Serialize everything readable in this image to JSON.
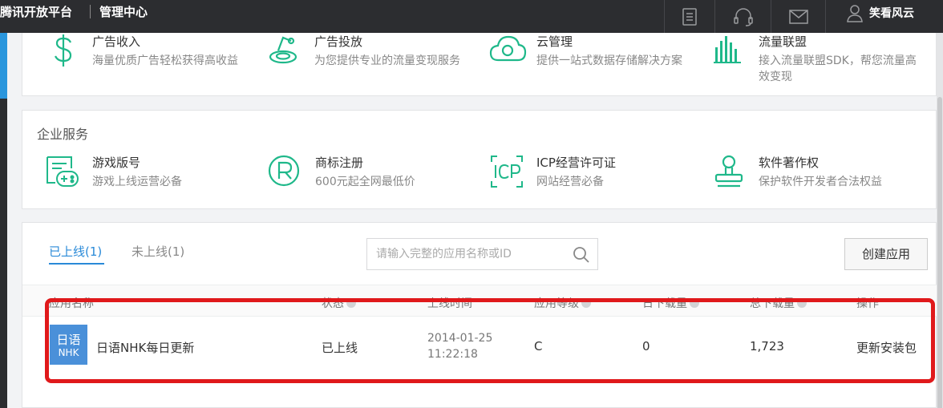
{
  "header": {
    "brand": "腾讯开放平台",
    "section": "管理中心",
    "user_name": "笑看风云",
    "nav_icons": [
      "document-icon",
      "headset-icon",
      "mail-icon",
      "user-icon"
    ]
  },
  "services_top": [
    {
      "icon": "dollar-icon",
      "title": "广告收入",
      "desc": "海量优质广告轻松获得高收益"
    },
    {
      "icon": "ad-placement-icon",
      "title": "广告投放",
      "desc": "为您提供专业的流量变现服务"
    },
    {
      "icon": "cloud-icon",
      "title": "云管理",
      "desc": "提供一站式数据存储解决方案"
    },
    {
      "icon": "bar-chart-icon",
      "title": "流量联盟",
      "desc": "接入流量联盟SDK，帮您流量高效变现"
    }
  ],
  "enterprise": {
    "title": "企业服务",
    "items": [
      {
        "icon": "game-license-icon",
        "title": "游戏版号",
        "desc": "游戏上线运营必备"
      },
      {
        "icon": "trademark-icon",
        "title": "商标注册",
        "desc": "600元起全网最低价"
      },
      {
        "icon": "icp-icon",
        "title": "ICP经营许可证",
        "desc": "网站经营必备"
      },
      {
        "icon": "stamp-icon",
        "title": "软件著作权",
        "desc": "保护软件开发者合法权益"
      }
    ]
  },
  "apps": {
    "tabs": [
      {
        "label": "已上线(1)",
        "active": true
      },
      {
        "label": "未上线(1)",
        "active": false
      }
    ],
    "search_placeholder": "请输入完整的应用名称或ID",
    "create_label": "创建应用",
    "columns": [
      "应用名称",
      "状态",
      "上线时间",
      "应用等级",
      "日下载量",
      "总下载量",
      "操作"
    ],
    "rows": [
      {
        "icon_line1": "日语",
        "icon_line2": "NHK",
        "name": "日语NHK每日更新",
        "status": "已上线",
        "online_date": "2014-01-25",
        "online_time": "11:22:18",
        "level": "C",
        "daily_downloads": "0",
        "total_downloads": "1,723",
        "action": "更新安装包"
      }
    ]
  },
  "colors": {
    "accent": "#2a8ad8",
    "service_icon": "#1fb88a",
    "highlight_border": "#e0191b",
    "topbar": "#2c2d30"
  }
}
